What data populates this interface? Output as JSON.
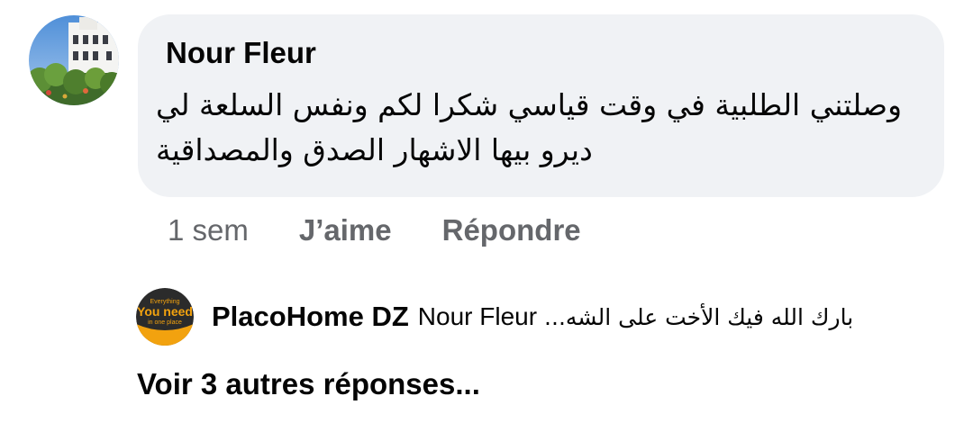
{
  "comment": {
    "author": "Nour Fleur",
    "text": "وصلتني الطلبية في وقت قياسي شكرا لكم ونفس السلعة لي ديرو بيها الاشهار الصدق والمصداقية",
    "avatar_icon": "profile-photo-building",
    "bubble_color": "#f0f2f5"
  },
  "actions": {
    "time": "1 sem",
    "like_label": "J’aime",
    "reply_label": "Répondre"
  },
  "reply": {
    "author": "PlacoHome DZ",
    "mention": "Nour Fleur",
    "snippet": "بارك الله فيك الأخت على الشه...",
    "avatar_icon": "brand-logo-you-need",
    "avatar_text": {
      "top": "Everything",
      "middle": "You need",
      "bottom": "in one place"
    }
  },
  "more_replies_label": "Voir 3 autres réponses..."
}
